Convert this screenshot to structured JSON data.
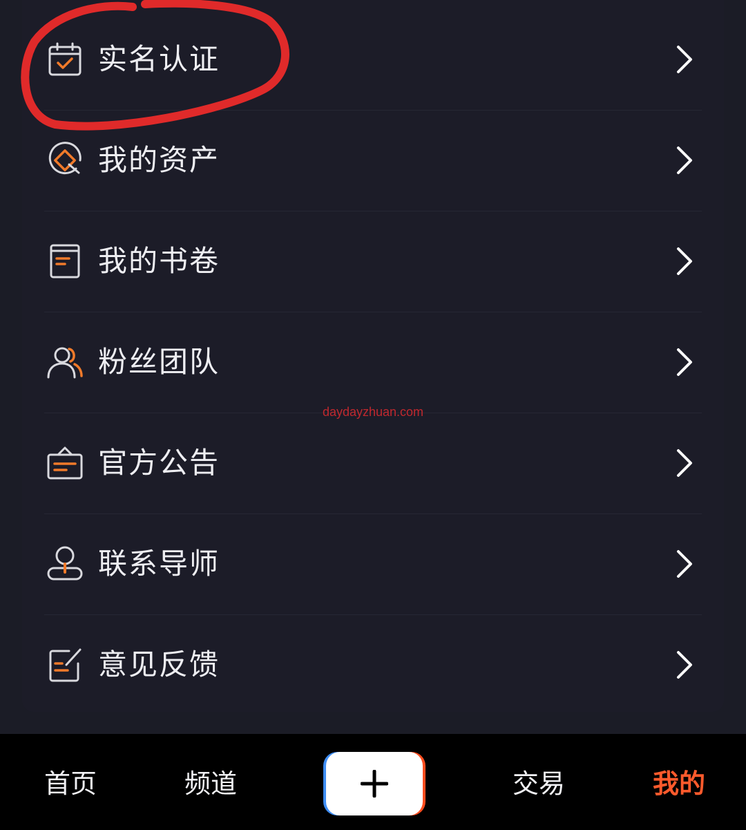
{
  "menu": {
    "items": [
      {
        "label": "实名认证",
        "icon": "calendar-check-icon"
      },
      {
        "label": "我的资产",
        "icon": "asset-diamond-icon"
      },
      {
        "label": "我的书卷",
        "icon": "book-icon"
      },
      {
        "label": "粉丝团队",
        "icon": "team-users-icon"
      },
      {
        "label": "官方公告",
        "icon": "announcement-bag-icon"
      },
      {
        "label": "联系导师",
        "icon": "mentor-user-icon"
      },
      {
        "label": "意见反馈",
        "icon": "feedback-edit-icon"
      }
    ]
  },
  "watermark": {
    "text": "daydayzhuan.com"
  },
  "tabbar": {
    "home": "首页",
    "channel": "频道",
    "trade": "交易",
    "mine": "我的",
    "plus_icon": "plus-icon"
  },
  "colors": {
    "background": "#1b1c26",
    "accent": "#ff5a2c",
    "icon_accent": "#f07a2a",
    "text": "#eeeef2",
    "annotation": "#e02a2a"
  }
}
